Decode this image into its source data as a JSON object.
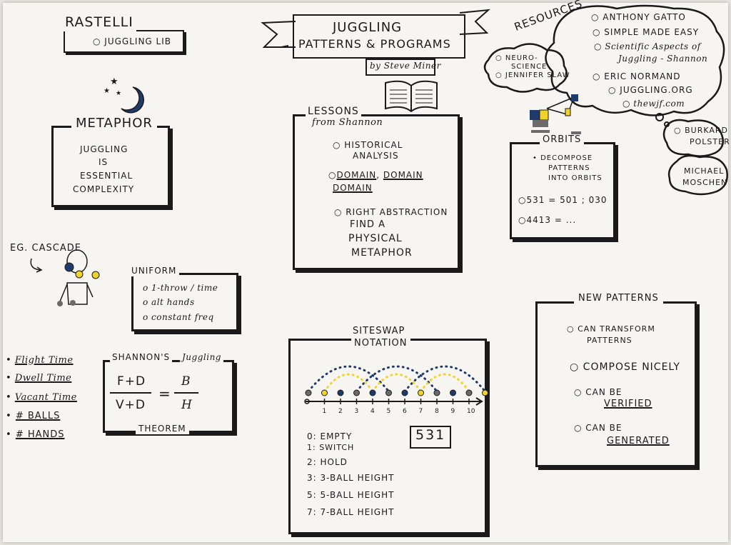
{
  "rastelli": {
    "title": "Rastelli",
    "item": "Juggling Lib"
  },
  "metaphor": {
    "heading": "Metaphor",
    "line1": "Juggling",
    "line2": "is",
    "line3": "Essential",
    "line4": "Complexity"
  },
  "cascade": {
    "label": "Eg. Cascade"
  },
  "uniform": {
    "heading": "Uniform",
    "items": [
      "1-throw / time",
      "alt hands",
      "constant freq"
    ]
  },
  "variables": [
    "Flight Time",
    "Dwell Time",
    "Vacant Time",
    "# Balls",
    "# Hands"
  ],
  "shannon_theorem": {
    "heading_left": "Shannon's",
    "heading_right": "Juggling",
    "num_left": "F+D",
    "den_left": "V+D",
    "equals": "=",
    "num_right": "B",
    "den_right": "H",
    "footer": "Theorem"
  },
  "title_banner": {
    "line1": "Juggling",
    "line2": "Patterns & Programs",
    "author": "by Steve Miner"
  },
  "lessons": {
    "heading1": "Lessons",
    "heading2": "from Shannon",
    "items": [
      "Historical",
      "Analysis",
      "Domain",
      "Domain",
      "Domain",
      "Right Abstraction",
      "Find a",
      "Physical",
      "Metaphor"
    ]
  },
  "siteswap": {
    "heading1": "Siteswap",
    "heading2": "Notation",
    "pattern": "531",
    "ticks": [
      "1",
      "2",
      "3",
      "4",
      "5",
      "6",
      "7",
      "8",
      "9",
      "10"
    ],
    "legend": [
      "0: Empty",
      "1: Switch",
      "2: Hold",
      "3: 3-Ball Height",
      "5: 5-Ball Height",
      "7: 7-Ball Height"
    ]
  },
  "resources": {
    "heading": "Resources",
    "items": [
      "Anthony Gatto",
      "Simple Made Easy",
      "Scientific Aspects of",
      "Juggling - Shannon",
      "Eric Normand",
      "Juggling.org",
      "thewjf.com"
    ],
    "left": [
      "Neuro-",
      "Science",
      "Jennifer Slaw"
    ],
    "burkard": [
      "Burkard",
      "Polster"
    ],
    "michael": [
      "Michael",
      "Moschen"
    ]
  },
  "orbits": {
    "heading": "Orbits",
    "items": [
      "Decompose",
      "Patterns",
      "into Orbits"
    ],
    "eq1": "531 = 501 ; 030",
    "eq2": "4413 = ..."
  },
  "new_patterns": {
    "heading": "New Patterns",
    "items": [
      "Can Transform",
      "Patterns",
      "Compose nicely",
      "Can Be",
      "Verified",
      "Can Be",
      "Generated"
    ]
  },
  "colors": {
    "ink": "#1a1a1a",
    "navy": "#1f3a6b",
    "yellow": "#f2d32a",
    "grey": "#6b6b6b"
  }
}
